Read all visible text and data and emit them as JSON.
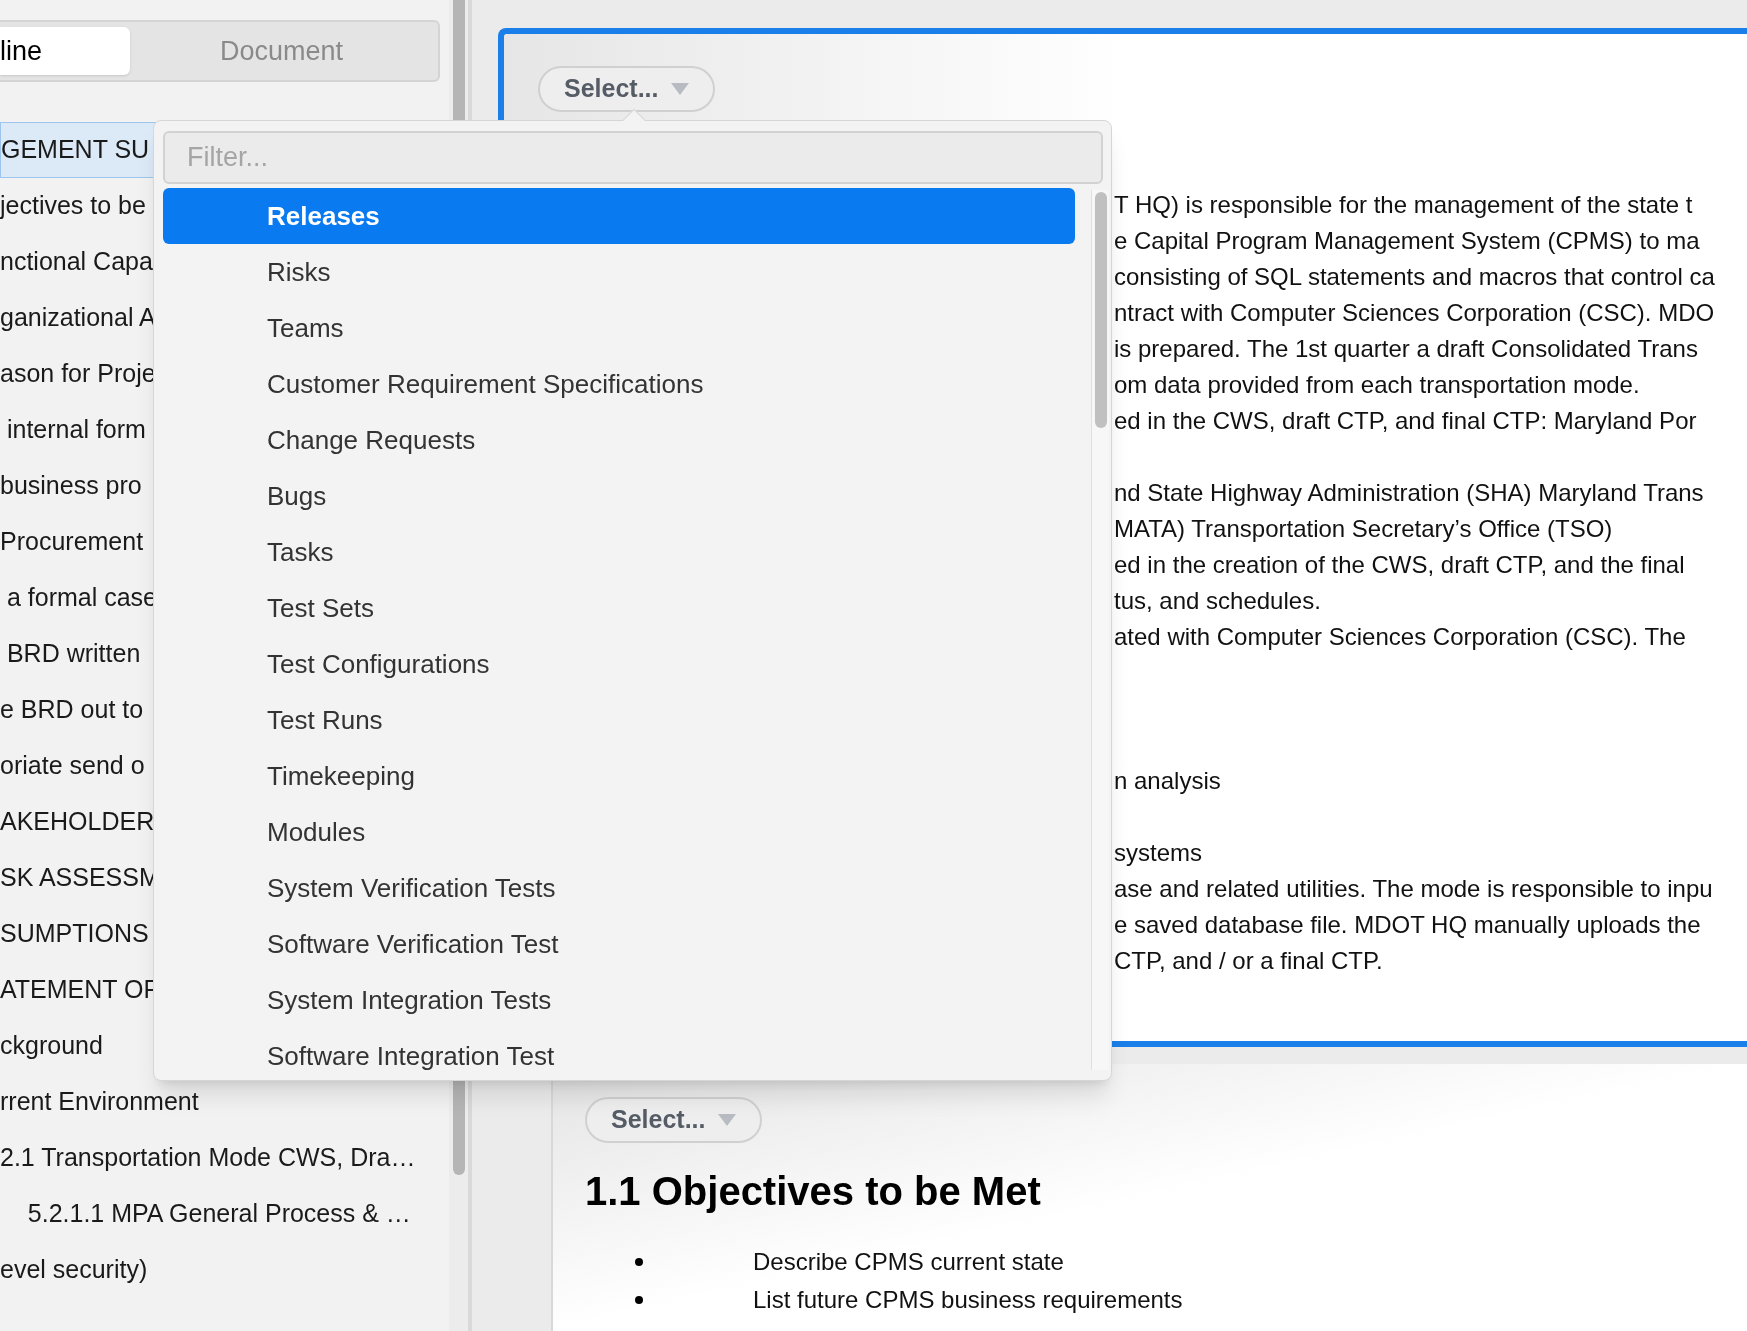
{
  "sidebar": {
    "tabs": [
      {
        "label": "line",
        "selected": true
      },
      {
        "label": "Document",
        "selected": false
      }
    ],
    "items": [
      {
        "text": "GEMENT SU",
        "selected": true
      },
      {
        "text": "jectives to be",
        "selected": false
      },
      {
        "text": "nctional Capa",
        "selected": false
      },
      {
        "text": "ganizational A",
        "selected": false
      },
      {
        "text": "ason for Proje",
        "selected": false
      },
      {
        "text": " internal form",
        "selected": false
      },
      {
        "text": "business pro",
        "selected": false
      },
      {
        "text": "Procurement",
        "selected": false
      },
      {
        "text": " a formal case",
        "selected": false
      },
      {
        "text": " BRD written",
        "selected": false
      },
      {
        "text": "e BRD out to",
        "selected": false
      },
      {
        "text": "oriate send o",
        "selected": false
      },
      {
        "text": "AKEHOLDER",
        "selected": false
      },
      {
        "text": "SK ASSESSM",
        "selected": false
      },
      {
        "text": "SUMPTIONS",
        "selected": false
      },
      {
        "text": "ATEMENT OF",
        "selected": false
      },
      {
        "text": "ckground",
        "selected": false
      },
      {
        "text": "rrent Environment",
        "selected": false
      },
      {
        "text": "2.1 Transportation Mode CWS, Dra…",
        "selected": false
      },
      {
        "text": "    5.2.1.1 MPA General Process & …",
        "selected": false
      },
      {
        "text": "evel security)",
        "selected": false
      }
    ]
  },
  "document": {
    "top_card": {
      "select_label": "Select...",
      "paragraphs": [
        [
          "T HQ) is responsible for the management of the state t",
          "e Capital Program Management System (CPMS) to ma",
          "consisting of SQL statements and macros that control ca",
          "ntract with Computer Sciences Corporation (CSC). MDO",
          "is prepared. The 1st quarter a draft Consolidated Trans",
          "om data provided from each transportation mode.",
          "ed in the CWS, draft CTP, and final CTP: Maryland Por"
        ],
        [
          "nd State Highway Administration (SHA) Maryland Trans",
          "MATA) Transportation Secretary’s Office (TSO)",
          "ed in the creation of the CWS, draft CTP, and the final",
          "tus, and schedules.",
          "ated with Computer Sciences Corporation (CSC). The"
        ],
        [
          "n analysis"
        ],
        [
          "systems",
          "ase and related utilities. The mode is responsible to inpu",
          "e saved database file. MDOT HQ manually uploads the",
          "CTP, and / or a final CTP."
        ]
      ]
    },
    "second_card": {
      "select_label": "Select...",
      "heading": "1.1 Objectives to be Met",
      "bullets": [
        "Describe CPMS current state",
        "List future CPMS business requirements"
      ]
    }
  },
  "dropdown": {
    "placeholder": "Filter...",
    "options": [
      {
        "label": "Releases",
        "selected": true
      },
      {
        "label": "Risks",
        "selected": false
      },
      {
        "label": "Teams",
        "selected": false
      },
      {
        "label": "Customer Requirement Specifications",
        "selected": false
      },
      {
        "label": "Change Requests",
        "selected": false
      },
      {
        "label": "Bugs",
        "selected": false
      },
      {
        "label": "Tasks",
        "selected": false
      },
      {
        "label": "Test Sets",
        "selected": false
      },
      {
        "label": "Test Configurations",
        "selected": false
      },
      {
        "label": "Test Runs",
        "selected": false
      },
      {
        "label": "Timekeeping",
        "selected": false
      },
      {
        "label": "Modules",
        "selected": false
      },
      {
        "label": "System Verification Tests",
        "selected": false
      },
      {
        "label": "Software Verification Test",
        "selected": false
      },
      {
        "label": "System Integration Tests",
        "selected": false
      },
      {
        "label": "Software Integration Test",
        "selected": false
      }
    ]
  }
}
